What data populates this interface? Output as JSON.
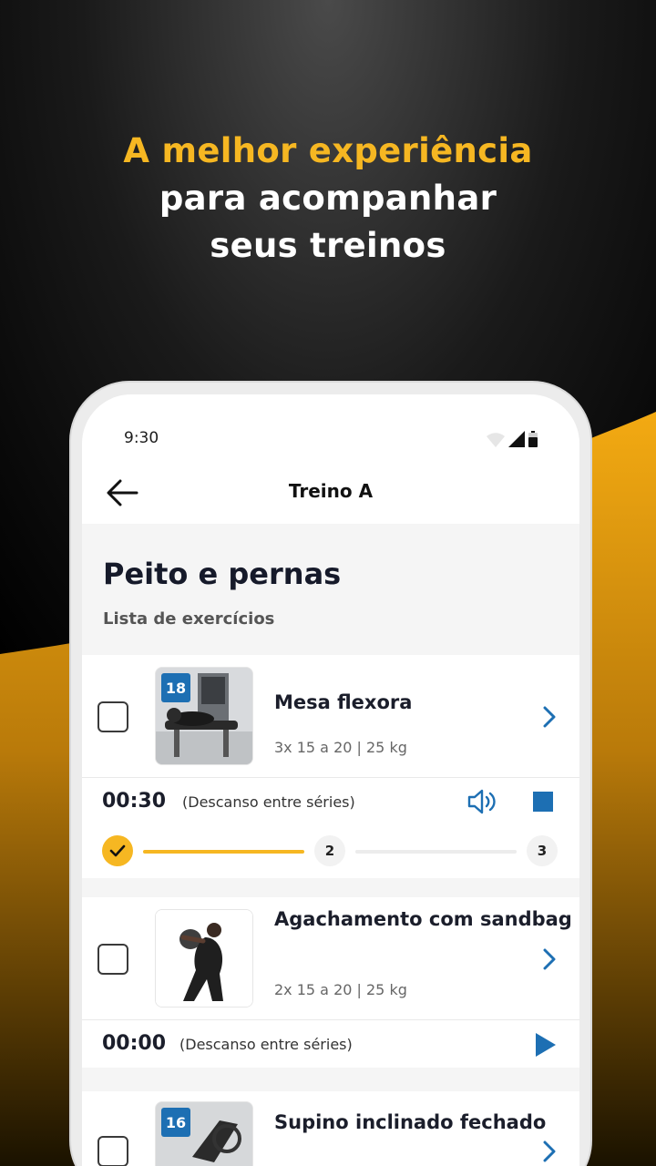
{
  "promo": {
    "headline_accent": "A melhor experiência",
    "headline_rest": "para acompanhar seus treinos"
  },
  "colors": {
    "accent": "#f6b722",
    "primary_blue": "#1d6fb3",
    "dark_text": "#1b1e2b"
  },
  "status_bar": {
    "time": "9:30",
    "icons": [
      "wifi-icon",
      "signal-icon",
      "battery-icon"
    ]
  },
  "app_bar": {
    "title": "Treino A",
    "back_icon": "arrow-left-icon"
  },
  "page": {
    "title": "Peito e pernas",
    "subtitle": "Lista de exercícios"
  },
  "exercises": [
    {
      "badge": "18",
      "name": "Mesa flexora",
      "meta": "3x 15 a 20 | 25 kg",
      "checked": false,
      "timer": "00:30",
      "timer_label": "(Descanso entre séries)",
      "controls": [
        "sound-icon",
        "stop-icon"
      ],
      "sets": {
        "completed": 1,
        "labels": [
          "2",
          "3"
        ]
      }
    },
    {
      "badge": "",
      "name": "Agachamento com sandbag",
      "meta": "2x 15 a 20 | 25 kg",
      "checked": false,
      "timer": "00:00",
      "timer_label": "(Descanso entre séries)",
      "controls": [
        "play-icon"
      ]
    },
    {
      "badge": "16",
      "name": "Supino inclinado fechado",
      "meta": "",
      "checked": false
    }
  ]
}
